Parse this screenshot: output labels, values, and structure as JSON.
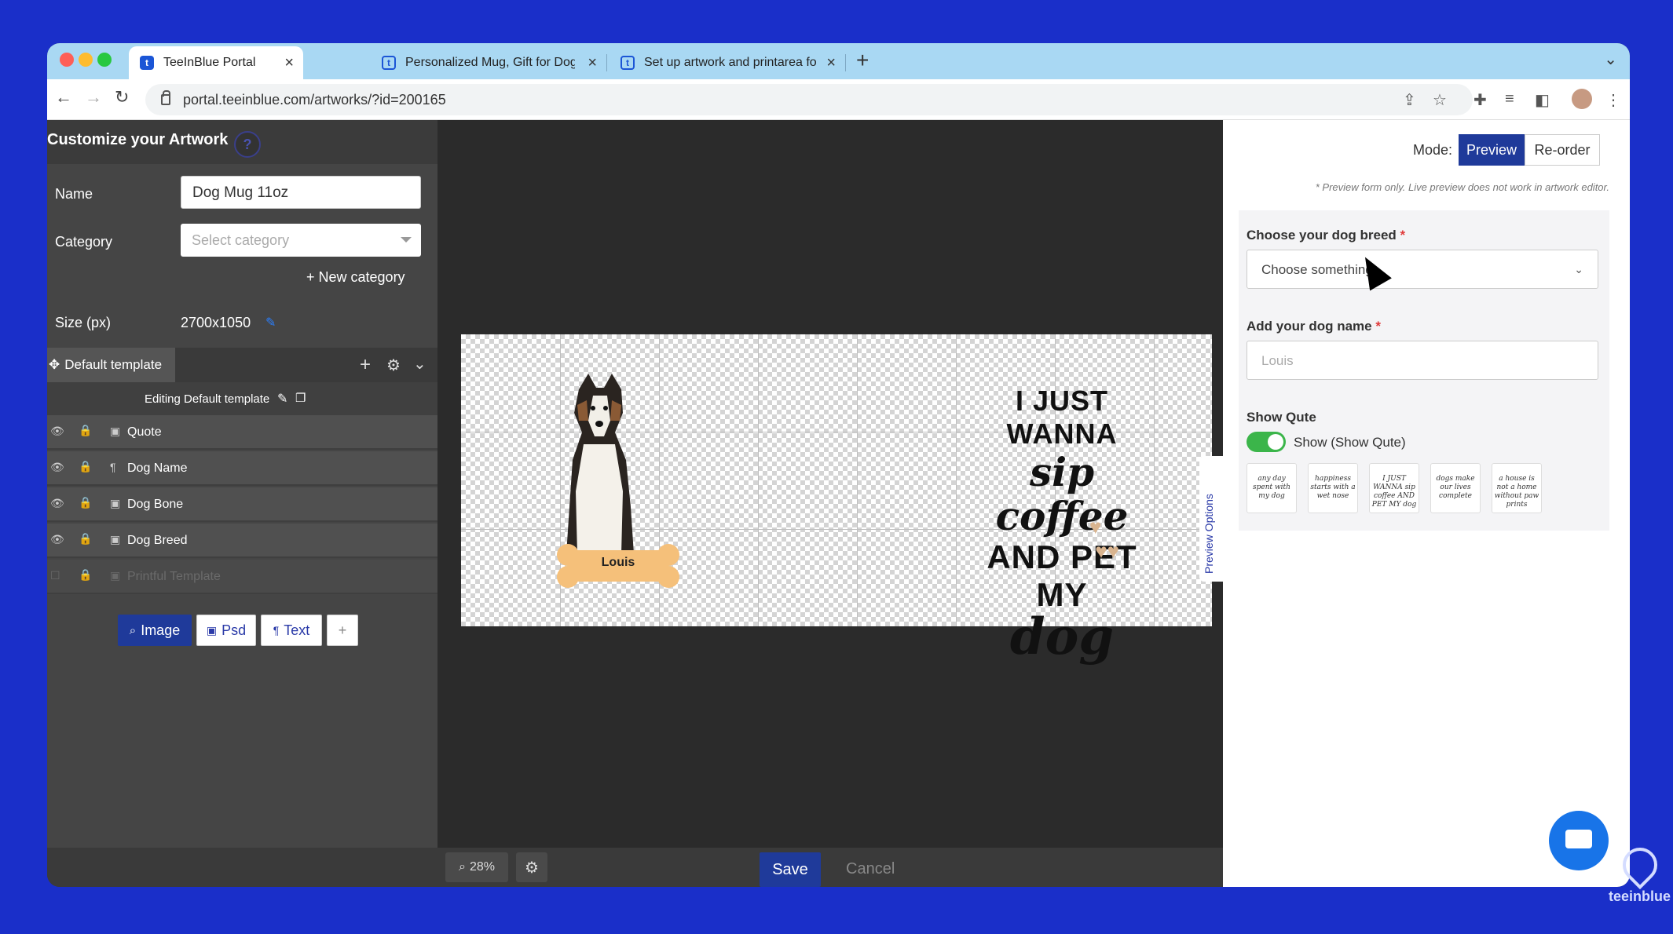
{
  "browser": {
    "tabs": [
      {
        "title": "TeeInBlue Portal",
        "active": true
      },
      {
        "title": "Personalized Mug, Gift for Dog",
        "active": false
      },
      {
        "title": "Set up artwork and printarea fo",
        "active": false
      }
    ],
    "url": "portal.teeinblue.com/artworks/?id=200165"
  },
  "left_panel": {
    "title": "Customize your Artwork",
    "name_label": "Name",
    "name_value": "Dog Mug 11oz",
    "category_label": "Category",
    "category_placeholder": "Select category",
    "new_category": "+ New category",
    "size_label": "Size (px)",
    "size_value": "2700x1050",
    "template_tab": "Default template",
    "editing_text": "Editing Default template",
    "layers": [
      {
        "name": "Quote",
        "type": "image",
        "visible": true
      },
      {
        "name": "Dog Name",
        "type": "text",
        "visible": true
      },
      {
        "name": "Dog Bone",
        "type": "image",
        "visible": true
      },
      {
        "name": "Dog Breed",
        "type": "image",
        "visible": true
      },
      {
        "name": "Printful Template",
        "type": "image",
        "visible": false
      }
    ],
    "add_buttons": {
      "image": "Image",
      "psd": "Psd",
      "text": "Text",
      "plus": "+"
    }
  },
  "canvas": {
    "dog_name": "Louis",
    "quote_lines": [
      "I JUST WANNA",
      "sip coffee",
      "AND PET MY",
      "dog"
    ],
    "zoom": "28%",
    "save": "Save",
    "cancel": "Cancel"
  },
  "right_panel": {
    "mode_label": "Mode:",
    "mode_preview": "Preview",
    "mode_reorder": "Re-order",
    "note": "* Preview form only. Live preview does not work in artwork editor.",
    "breed_label": "Choose your dog breed",
    "breed_placeholder": "Choose something...",
    "dogname_label": "Add your dog name",
    "dogname_placeholder": "Louis",
    "show_label": "Show Qute",
    "toggle_label": "Show (Show Qute)",
    "side_tab": "Preview Options",
    "thumbnails": [
      "any day spent with my dog",
      "happiness starts with a wet nose",
      "I JUST WANNA sip coffee AND PET MY dog",
      "dogs make our lives complete",
      "a house is not a home without paw prints"
    ]
  },
  "brand": "teeinblue",
  "colors": {
    "accent": "#1f3a9a",
    "toggle": "#3bb54a",
    "background": "#1a2fc9"
  }
}
